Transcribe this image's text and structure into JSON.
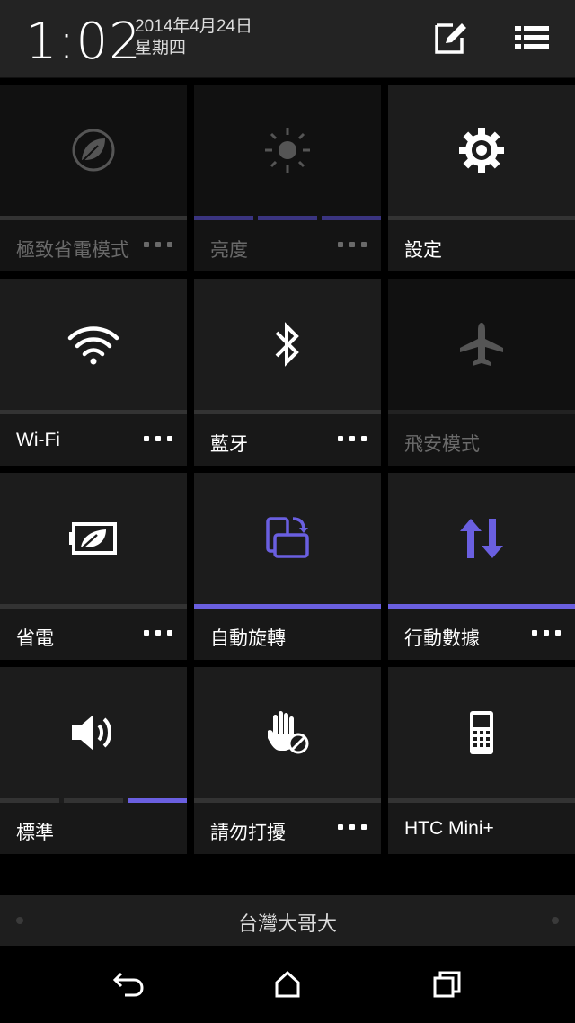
{
  "header": {
    "time": "1:02",
    "date": "2014年4月24日",
    "weekday": "星期四",
    "edit_icon": "edit-icon",
    "list_icon": "list-icon"
  },
  "tiles": [
    {
      "label": "極致省電模式",
      "icon": "leaf-icon",
      "active": false,
      "disabled": true,
      "has_more": true
    },
    {
      "label": "亮度",
      "icon": "brightness-icon",
      "active": false,
      "disabled": true,
      "has_more": true,
      "level": "3 of 3 segments"
    },
    {
      "label": "設定",
      "icon": "gear-icon",
      "active": false,
      "disabled": false,
      "has_more": false
    },
    {
      "label": "Wi-Fi",
      "icon": "wifi-icon",
      "active": false,
      "disabled": false,
      "has_more": true
    },
    {
      "label": "藍牙",
      "icon": "bluetooth-icon",
      "active": false,
      "disabled": false,
      "has_more": true
    },
    {
      "label": "飛安模式",
      "icon": "airplane-icon",
      "active": false,
      "disabled": true,
      "has_more": false
    },
    {
      "label": "省電",
      "icon": "battery-saver-icon",
      "active": false,
      "disabled": false,
      "has_more": true
    },
    {
      "label": "自動旋轉",
      "icon": "auto-rotate-icon",
      "active": true,
      "disabled": false,
      "has_more": false
    },
    {
      "label": "行動數據",
      "icon": "mobile-data-icon",
      "active": true,
      "disabled": false,
      "has_more": true
    },
    {
      "label": "標準",
      "icon": "volume-icon",
      "active": false,
      "disabled": false,
      "has_more": false,
      "level": "1 of 3 segments"
    },
    {
      "label": "請勿打擾",
      "icon": "do-not-disturb-icon",
      "active": false,
      "disabled": false,
      "has_more": true
    },
    {
      "label": "HTC Mini+",
      "icon": "htc-mini-icon",
      "active": false,
      "disabled": false,
      "has_more": false
    }
  ],
  "carrier": "台灣大哥大",
  "navbar": {
    "back_icon": "back-icon",
    "home_icon": "home-icon",
    "recents_icon": "recent-apps-icon"
  },
  "colors": {
    "accent": "#6a5fe0",
    "tile": "#1c1c1c",
    "tile_dim": "#111111"
  }
}
